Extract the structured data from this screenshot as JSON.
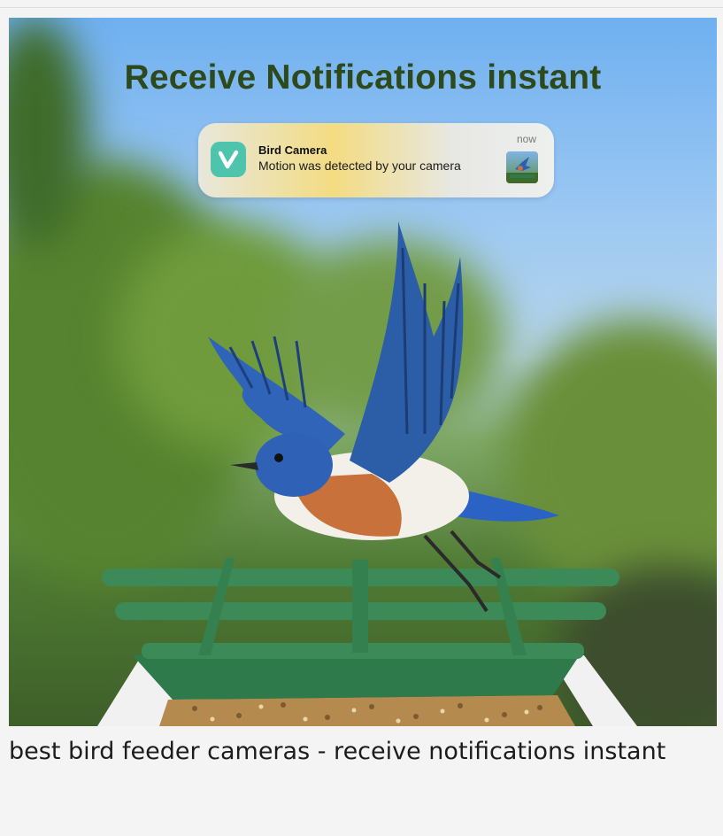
{
  "hero": {
    "title": "Receive Notifications instant",
    "image_icon": "bluebird-on-feeder-image"
  },
  "notification": {
    "app_name": "Bird Camera",
    "message": "Motion was detected by your camera",
    "time": "now",
    "app_icon": "v-logo-icon",
    "thumbnail_icon": "bird-thumbnail-icon",
    "app_icon_color": "#4ec4ad"
  },
  "caption": {
    "text": "best bird feeder cameras - receive notifications instant"
  }
}
